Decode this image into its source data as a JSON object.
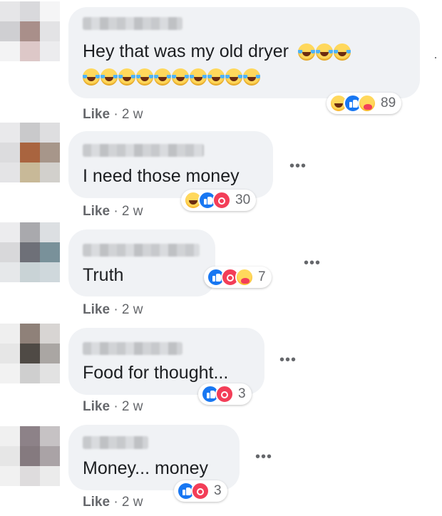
{
  "comments": [
    {
      "text": "Hey that was my old dryer",
      "emoji_lines": [
        3,
        10
      ],
      "emoji_icon": "rolling-on-floor-laughing-emoji",
      "like_label": "Like",
      "time": "· 2 w",
      "reactions": [
        "haha-reaction-icon",
        "like-reaction-icon",
        "care-reaction-icon"
      ],
      "reaction_count": "89",
      "avatar_colors": [
        "#e6e6e8",
        "#d9d9dc",
        "#f5f5f6",
        "#cfcfd2",
        "#a98f8a",
        "#e3e3e5",
        "#f3f3f4",
        "#ddc8c8",
        "#ececee"
      ]
    },
    {
      "text": "I need those money",
      "like_label": "Like",
      "time": "· 2 w",
      "reactions": [
        "haha-reaction-icon",
        "like-reaction-icon",
        "love-reaction-icon"
      ],
      "reaction_count": "30",
      "avatar_colors": [
        "#e9e9eb",
        "#c9c9cb",
        "#dedee0",
        "#dcdcde",
        "#a9643f",
        "#a7968a",
        "#e4e4e6",
        "#c8b998",
        "#d2d0cc"
      ]
    },
    {
      "text": "Truth",
      "like_label": "Like",
      "time": "· 2 w",
      "reactions": [
        "like-reaction-icon",
        "love-reaction-icon",
        "care-reaction-icon"
      ],
      "reaction_count": "7",
      "avatar_colors": [
        "#ececee",
        "#a9a9ad",
        "#dcdfe2",
        "#d8d8da",
        "#6e7078",
        "#79919a",
        "#e6e8ea",
        "#c9d3d6",
        "#cfd8dc"
      ]
    },
    {
      "text": "Food for thought...",
      "like_label": "Like",
      "time": "· 2 w",
      "reactions": [
        "like-reaction-icon",
        "love-reaction-icon"
      ],
      "reaction_count": "3",
      "avatar_colors": [
        "#efefef",
        "#8f8179",
        "#d8d5d3",
        "#e6e6e6",
        "#4f4a45",
        "#aaa6a3",
        "#f2f2f2",
        "#cfcfcf",
        "#e2e2e2"
      ]
    },
    {
      "text": "Money... money",
      "like_label": "Like",
      "time": "· 2 w",
      "reactions": [
        "like-reaction-icon",
        "love-reaction-icon"
      ],
      "reaction_count": "3",
      "avatar_colors": [
        "#f0f0f0",
        "#8d8288",
        "#c6c2c4",
        "#e6e6e6",
        "#857a7f",
        "#aaa3a6",
        "#f1f1f1",
        "#dedcdd",
        "#ebebeb"
      ]
    }
  ],
  "more_menu_icon": "more-options-ellipsis-icon",
  "colors": {
    "bubble": "#f0f2f5",
    "meta_text": "#65676b",
    "like_blue": "#1877f2",
    "love_red": "#f33e58",
    "haha_yellow": "#ffd85c"
  }
}
